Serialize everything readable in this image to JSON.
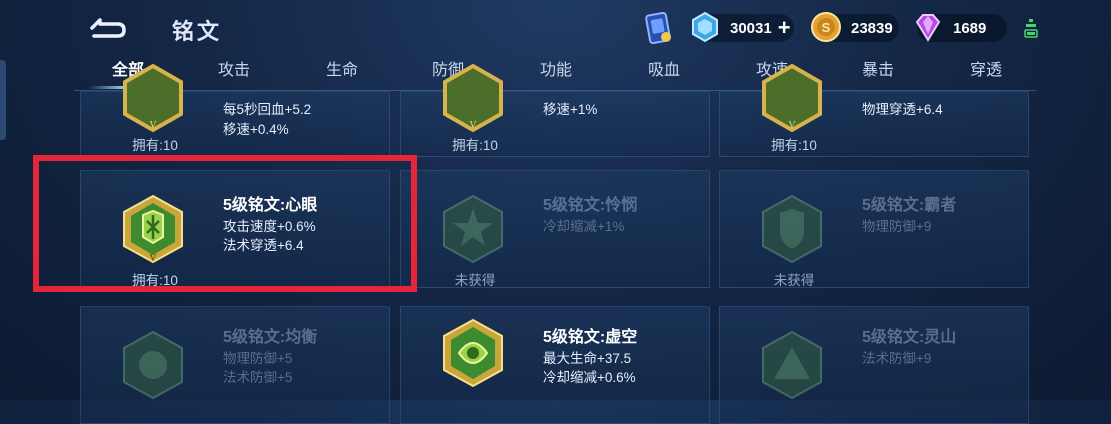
{
  "header": {
    "title": "铭文",
    "currencies": [
      {
        "name": "diamond",
        "amount": "30031"
      },
      {
        "name": "gold",
        "amount": "23839"
      },
      {
        "name": "gem",
        "amount": "1689"
      }
    ]
  },
  "tabs": [
    "全部",
    "攻击",
    "生命",
    "防御",
    "功能",
    "吸血",
    "攻速",
    "暴击",
    "穿透"
  ],
  "active_tab": "全部",
  "cards": {
    "r0c0": {
      "attr1": "每5秒回血+5.2",
      "attr2": "移速+0.4%",
      "status": "拥有:10"
    },
    "r0c1": {
      "attr1": "移速+1%",
      "status": "拥有:10"
    },
    "r0c2": {
      "attr1": "物理穿透+6.4",
      "status": "拥有:10"
    },
    "r1c0": {
      "name": "5级铭文:心眼",
      "attr1": "攻击速度+0.6%",
      "attr2": "法术穿透+6.4",
      "status": "拥有:10"
    },
    "r1c1": {
      "name": "5级铭文:怜悯",
      "attr1": "冷却缩减+1%",
      "status": "未获得"
    },
    "r1c2": {
      "name": "5级铭文:霸者",
      "attr1": "物理防御+9",
      "status": "未获得"
    },
    "r2c0": {
      "name": "5级铭文:均衡",
      "attr1": "物理防御+5",
      "attr2": "法术防御+5"
    },
    "r2c1": {
      "name": "5级铭文:虚空",
      "attr1": "最大生命+37.5",
      "attr2": "冷却缩减+0.6%"
    },
    "r2c2": {
      "name": "5级铭文:灵山",
      "attr1": "法术防御+9"
    }
  },
  "colors": {
    "highlight": "#e4263a",
    "emblem_gold": "#d8b24a",
    "emblem_green": "#3e8a2e"
  }
}
